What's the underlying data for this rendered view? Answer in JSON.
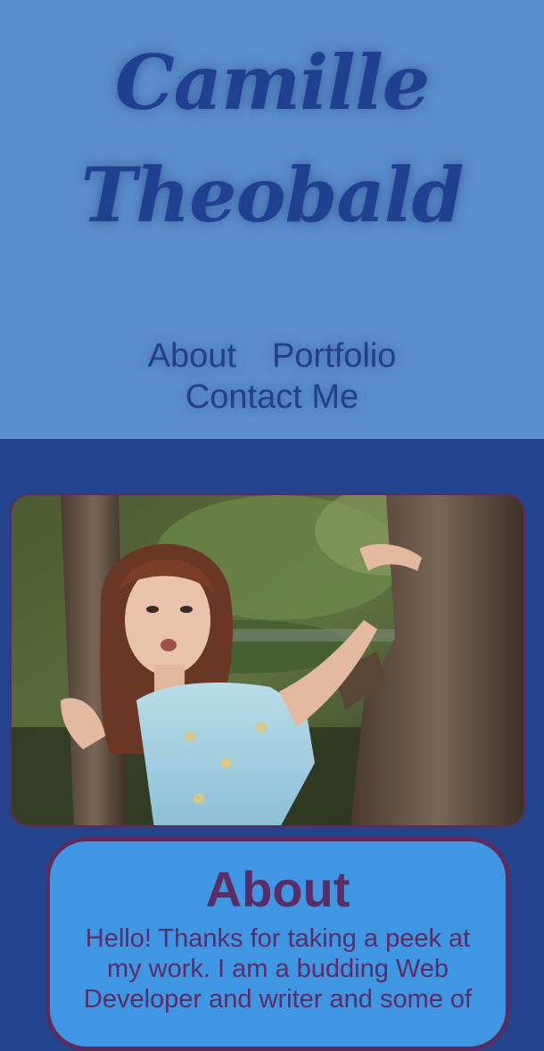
{
  "header": {
    "title_line1": "Camille",
    "title_line2": "Theobald"
  },
  "nav": {
    "items": [
      {
        "label": "About"
      },
      {
        "label": "Portfolio"
      },
      {
        "label": "Contact Me"
      }
    ]
  },
  "hero": {
    "photo_icon": "portrait-photo"
  },
  "about": {
    "heading": "About",
    "text": "Hello! Thanks for taking a peek at my work. I am a budding Web Developer and writer and some of"
  },
  "colors": {
    "header_bg": "#5b8ecc",
    "page_bg": "#23448c",
    "title_color": "#1f4190",
    "card_bg": "#3f97e3",
    "card_border": "#5d2a5c",
    "card_text": "#5b2c66"
  }
}
